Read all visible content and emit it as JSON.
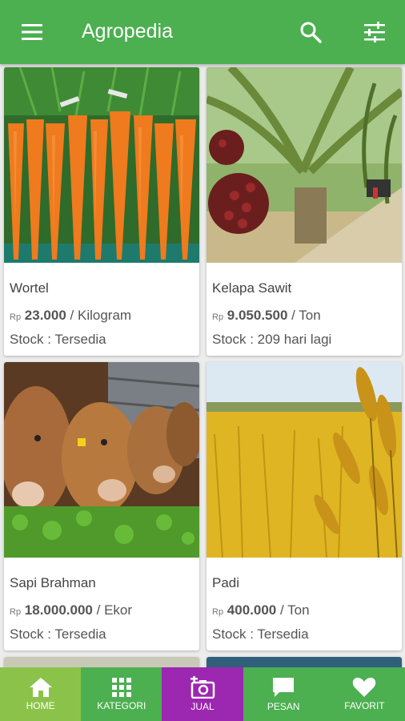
{
  "appbar": {
    "title": "Agropedia",
    "color": "#4caf50",
    "icons": [
      "menu-icon",
      "search-icon",
      "tune-icon"
    ]
  },
  "products": [
    {
      "name": "Wortel",
      "currency": "Rp",
      "price": "23.000",
      "unit": "/ Kilogram",
      "stock": "Stock : Tersedia",
      "image": "carrots"
    },
    {
      "name": "Kelapa Sawit",
      "currency": "Rp",
      "price": "9.050.500",
      "unit": "/ Ton",
      "stock": "Stock : 209 hari lagi",
      "image": "palm-oil"
    },
    {
      "name": "Sapi Brahman",
      "currency": "Rp",
      "price": "18.000.000",
      "unit": "/ Ekor",
      "stock": "Stock : Tersedia",
      "image": "cattle"
    },
    {
      "name": "Padi",
      "currency": "Rp",
      "price": "400.000",
      "unit": "/ Ton",
      "stock": "Stock : Tersedia",
      "image": "rice-field"
    }
  ],
  "bottom_nav": [
    {
      "label": "HOME",
      "icon": "home-icon",
      "color": "#8bc34a"
    },
    {
      "label": "KATEGORI",
      "icon": "grid-icon",
      "color": "#4caf50"
    },
    {
      "label": "JUAL",
      "icon": "add-photo-icon",
      "color": "#9c27b0"
    },
    {
      "label": "PESAN",
      "icon": "chat-icon",
      "color": "#4caf50"
    },
    {
      "label": "FAVORIT",
      "icon": "heart-icon",
      "color": "#4caf50"
    }
  ]
}
